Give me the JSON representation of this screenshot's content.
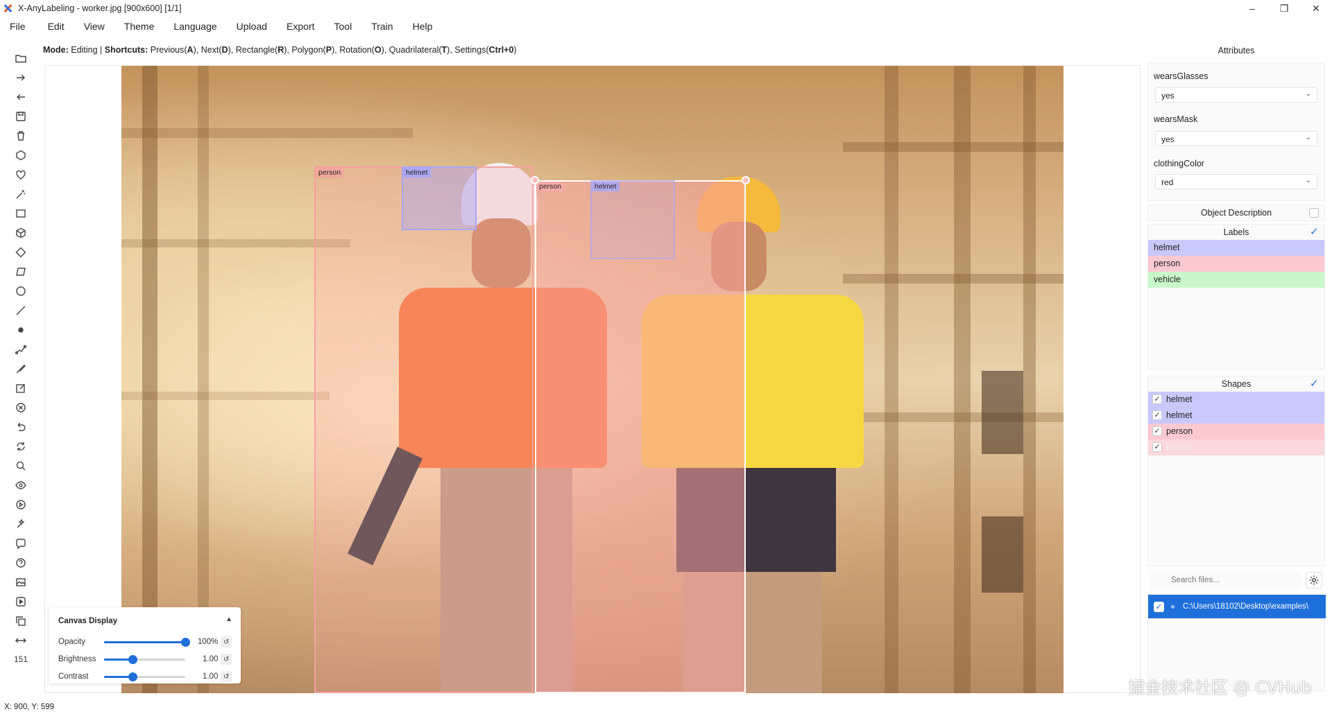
{
  "window": {
    "title": "X-AnyLabeling - worker.jpg [900x600] [1/1]",
    "controls": [
      "–",
      "❐",
      "✕"
    ]
  },
  "menu": [
    "File",
    "Edit",
    "View",
    "Theme",
    "Language",
    "Upload",
    "Export",
    "Tool",
    "Train",
    "Help"
  ],
  "mode_line": {
    "mode_label": "Mode:",
    "mode_value": "Editing",
    "sep": "|",
    "shortcuts_label": "Shortcuts:",
    "items": [
      {
        "name": "Previous",
        "key": "A"
      },
      {
        "name": "Next",
        "key": "D"
      },
      {
        "name": "Rectangle",
        "key": "R"
      },
      {
        "name": "Polygon",
        "key": "P"
      },
      {
        "name": "Rotation",
        "key": "O"
      },
      {
        "name": "Quadrilateral",
        "key": "T"
      },
      {
        "name": "Settings",
        "key": "Ctrl+0"
      }
    ]
  },
  "toolbar": {
    "tools": [
      "open-folder-icon",
      "next-image-icon",
      "prev-image-icon",
      "save-icon",
      "delete-icon",
      "polygon-icon",
      "heart-icon",
      "magic-wand-icon",
      "rectangle-icon",
      "cube-icon",
      "rotation-icon",
      "quadrilateral-icon",
      "circle-icon",
      "line-icon",
      "point-icon",
      "linestrip-icon",
      "brush-icon",
      "edit-icon",
      "delete-shape-icon",
      "undo-icon",
      "redo-icon",
      "zoom-icon",
      "visibility-icon",
      "play-icon",
      "auto-label-icon",
      "chat-icon",
      "help-icon",
      "image-icon",
      "video-icon",
      "copy-icon",
      "fit-width-icon"
    ],
    "zoom_level": "151"
  },
  "canvas": {
    "boxes": [
      {
        "label": "person",
        "color": "#f7a0a0"
      },
      {
        "label": "helmet",
        "color": "#a9a6f5"
      },
      {
        "label": "person",
        "color": "#f7a0a0"
      },
      {
        "label": "helmet",
        "color": "#a9a6f5"
      }
    ]
  },
  "canvas_display": {
    "title": "Canvas Display",
    "rows": [
      {
        "label": "Opacity",
        "value": "100%",
        "level": 1.0
      },
      {
        "label": "Brightness",
        "value": "1.00",
        "level": 0.35
      },
      {
        "label": "Contrast",
        "value": "1.00",
        "level": 0.35
      }
    ]
  },
  "attributes": {
    "title": "Attributes",
    "fields": [
      {
        "name": "wearsGlasses",
        "value": "yes"
      },
      {
        "name": "wearsMask",
        "value": "yes"
      },
      {
        "name": "clothingColor",
        "value": "red"
      }
    ]
  },
  "object_description": {
    "label": "Object Description",
    "checked": false
  },
  "labels": {
    "title": "Labels",
    "checked": true,
    "items": [
      {
        "name": "helmet",
        "color": "#c9c8fb"
      },
      {
        "name": "person",
        "color": "#fbc9d0"
      },
      {
        "name": "vehicle",
        "color": "#c9f7cb"
      }
    ]
  },
  "shapes": {
    "title": "Shapes",
    "checked": true,
    "items": [
      {
        "name": "helmet",
        "color": "#c9c8fb"
      },
      {
        "name": "helmet",
        "color": "#c9c8fb"
      },
      {
        "name": "person",
        "color": "#fbc9d0"
      },
      {
        "name": "person",
        "color": "#fbd8dc"
      }
    ]
  },
  "search": {
    "placeholder": "Search files..."
  },
  "files": [
    {
      "path": "C:\\Users\\18102\\Desktop\\examples\\",
      "checked": true
    }
  ],
  "watermark": "掘金技术社区 @ CVHub",
  "status": "X: 900, Y: 599"
}
